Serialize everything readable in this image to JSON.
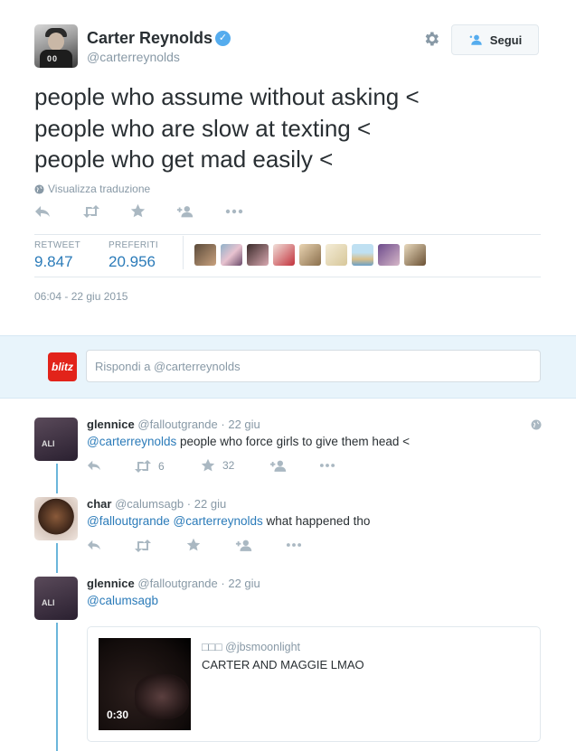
{
  "author": {
    "name": "Carter Reynolds",
    "handle": "@carterreynolds",
    "avatar_shirt_text": "00",
    "verified_icon": "check"
  },
  "follow_button": {
    "label": "Segui"
  },
  "tweet": {
    "text": "people who assume without asking <\npeople who are slow at texting <\npeople who get mad easily <",
    "translate_label": "Visualizza traduzione"
  },
  "stats": {
    "retweets_label": "RETWEET",
    "retweets_value": "9.847",
    "favorites_label": "PREFERITI",
    "favorites_value": "20.956"
  },
  "timestamp": "06:04 - 22 giu 2015",
  "reply_composer": {
    "placeholder": "Rispondi a @carterreynolds",
    "avatar_text": "blitz"
  },
  "replies": [
    {
      "name": "glennice",
      "handle": "@falloutgrande",
      "date": "22 giu",
      "mention": "@carterreynolds",
      "text": " people who force girls to give them head <",
      "retweets": "6",
      "favorites": "32"
    },
    {
      "name": "char",
      "handle": "@calumsagb",
      "date": "22 giu",
      "mention": "@falloutgrande @carterreynolds",
      "text": " what happened tho"
    },
    {
      "name": "glennice",
      "handle": "@falloutgrande",
      "date": "22 giu",
      "mention": "@calumsagb",
      "text": ""
    }
  ],
  "embedded_card": {
    "account_glyphs": "□□□",
    "handle": "@jbsmoonlight",
    "text": "CARTER AND MAGGIE LMAO",
    "video_duration": "0:30"
  },
  "colors": {
    "link": "#2b7bb9",
    "muted": "#8899a6",
    "icon": "#aab8c2",
    "verified": "#55acee",
    "thread_line": "#6bb6da",
    "reply_bg": "#e8f4fb"
  }
}
